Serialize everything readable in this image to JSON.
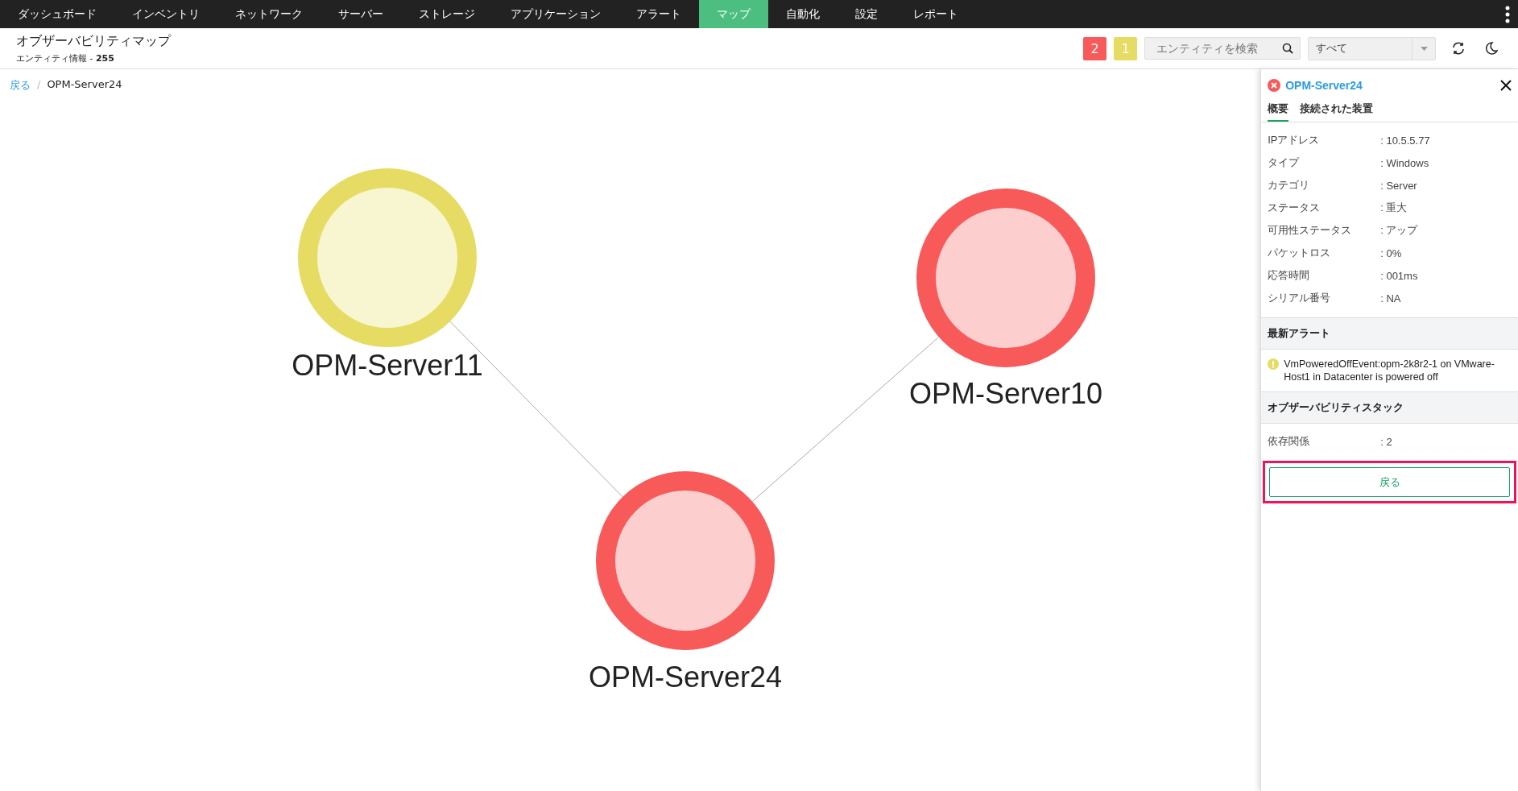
{
  "nav": {
    "items": [
      {
        "label": "ダッシュボード",
        "selected": false
      },
      {
        "label": "インベントリ",
        "selected": false
      },
      {
        "label": "ネットワーク",
        "selected": false
      },
      {
        "label": "サーバー",
        "selected": false
      },
      {
        "label": "ストレージ",
        "selected": false
      },
      {
        "label": "アプリケーション",
        "selected": false
      },
      {
        "label": "アラート",
        "selected": false
      },
      {
        "label": "マップ",
        "selected": true
      },
      {
        "label": "自動化",
        "selected": false
      },
      {
        "label": "設定",
        "selected": false
      },
      {
        "label": "レポート",
        "selected": false
      }
    ]
  },
  "header": {
    "title": "オブザーバビリティマップ",
    "subtitle": "エンティティ情報 - **255**",
    "badges": [
      {
        "count": "2",
        "color": "#f85a5a"
      },
      {
        "count": "1",
        "color": "#e6dc64"
      }
    ],
    "search": {
      "placeholder": "エンティティを検索"
    },
    "filter": {
      "value": "すべて"
    }
  },
  "breadcrumb": {
    "link": "戻る",
    "separator": "/",
    "current": "OPM-Server24"
  },
  "map": {
    "nodes": [
      {
        "label": "OPM-Server11",
        "color": "#e6dc64"
      },
      {
        "label": "OPM-Server10",
        "color": "#f85a5a"
      },
      {
        "label": "OPM-Server24",
        "color": "#f85a5a"
      }
    ]
  },
  "panel": {
    "title": "OPM-Server24",
    "color": "#f85a5a",
    "tabs": [
      {
        "label": "概要",
        "selected": true
      },
      {
        "label": "接続された装置",
        "selected": false
      }
    ],
    "properties": [
      {
        "label": "IPアドレス",
        "value": ": 10.5.5.77"
      },
      {
        "label": "タイプ",
        "value": ": Windows"
      },
      {
        "label": "カテゴリ",
        "value": ": Server"
      },
      {
        "label": "ステータス",
        "value": ": 重大"
      },
      {
        "label": "可用性ステータス",
        "value": ": アップ"
      },
      {
        "label": "パケットロス",
        "value": ": 0%"
      },
      {
        "label": "応答時間",
        "value": ": 001ms"
      },
      {
        "label": "シリアル番号",
        "value": ": NA"
      }
    ],
    "alerts_heading": "最新アラート",
    "alerts": [
      {
        "text": "VmPoweredOffEvent:opm-2k8r2-1 on VMware-Host1 in Datacenter is powered off",
        "color": "#e6dc64"
      }
    ],
    "stack_heading": "オブザーバビリティスタック",
    "stack": [
      {
        "label": "依存関係",
        "value": ": 2"
      }
    ],
    "back_button": {
      "label": "戻る",
      "highlighted": true
    }
  }
}
